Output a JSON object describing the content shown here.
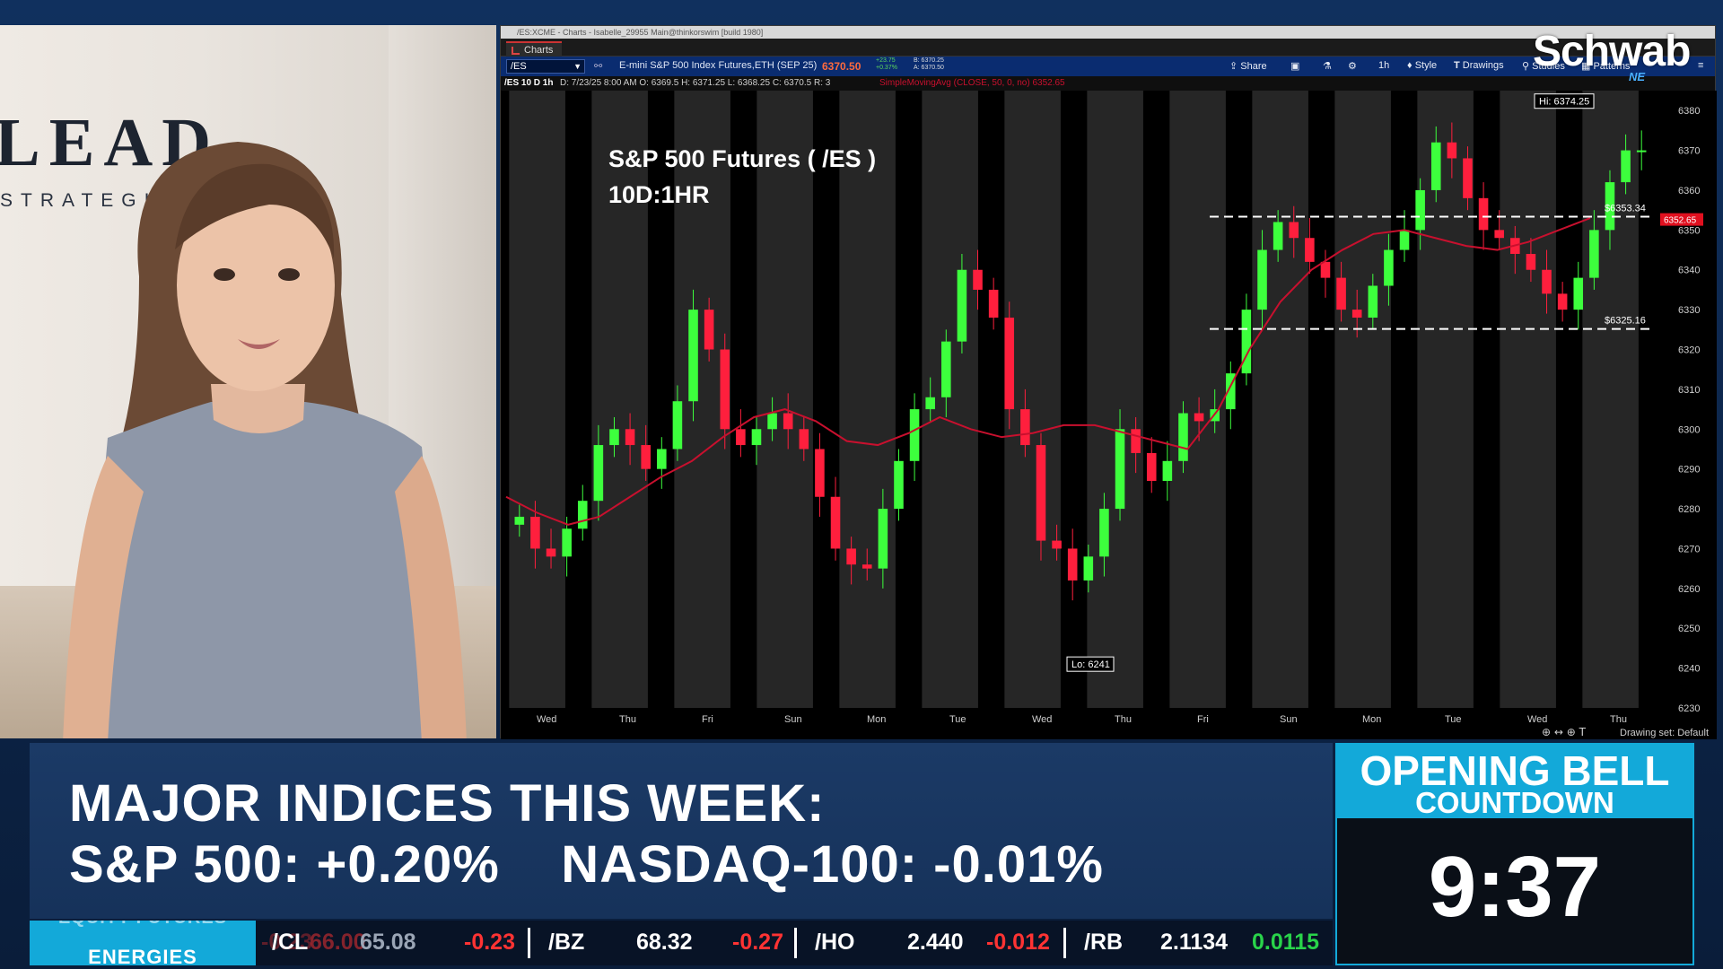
{
  "presenter": {
    "logo_main": "LEAD",
    "logo_sub": "STRATEGIES"
  },
  "chart_window": {
    "title_text": "/ES:XCME - Charts - Isabelle_29955 Main@thinkorswim [build 1980]",
    "tab_label": "Charts",
    "symbol": "/ES",
    "description": "E-mini S&P 500 Index Futures,ETH (SEP 25)",
    "last_price": "6370.50",
    "net_change": "+23.75",
    "pct_change": "+0.37%",
    "bid": "B: 6370.25",
    "ask": "A: 6370.50",
    "toolbar": {
      "share": "Share",
      "timeframe": "1h",
      "style": "Style",
      "drawings": "Drawings",
      "studies": "Studies",
      "patterns": "Patterns"
    },
    "info_bar": {
      "symbol_period": "/ES 10 D 1h",
      "ohlc": "D: 7/23/25 8:00 AM  O: 6369.5  H: 6371.25  L: 6368.25  C: 6370.5  R: 3",
      "study": "SimpleMovingAvg (CLOSE, 50, 0, no)  6352.65"
    },
    "footer": {
      "drawing_set": "Drawing set: Default"
    }
  },
  "chart_data": {
    "type": "candlestick",
    "title": "S&P 500 Futures ( /ES )",
    "subtitle": "10D:1HR",
    "ylim": [
      6230,
      6385
    ],
    "y_ticks": [
      6380,
      6370,
      6360,
      6350,
      6340,
      6330,
      6320,
      6310,
      6300,
      6290,
      6280,
      6270,
      6260,
      6250,
      6240,
      6230
    ],
    "x_labels": [
      "Wed",
      "Thu",
      "Fri",
      "Sun",
      "Mon",
      "Tue",
      "Wed",
      "Thu",
      "Fri",
      "Sun",
      "Mon",
      "Tue",
      "Wed",
      "Thu"
    ],
    "high_label": "Hi: 6374.25",
    "low_label": "Lo: 6241",
    "current_price_label": "6352.65",
    "horizontal_lines": [
      {
        "label": "$6353.34",
        "value": 6353.34
      },
      {
        "label": "$6325.16",
        "value": 6325.16
      }
    ],
    "moving_average": {
      "name": "SimpleMovingAvg (CLOSE, 50)",
      "values": [
        6283,
        6279,
        6276,
        6278,
        6283,
        6288,
        6292,
        6298,
        6303,
        6305,
        6302,
        6297,
        6296,
        6299,
        6303,
        6300,
        6298,
        6299,
        6301,
        6301,
        6299,
        6297,
        6295,
        6305,
        6320,
        6332,
        6340,
        6345,
        6349,
        6350,
        6348,
        6346,
        6345,
        6347,
        6350,
        6353
      ]
    },
    "closes": [
      6278,
      6270,
      6268,
      6275,
      6282,
      6296,
      6300,
      6296,
      6290,
      6295,
      6307,
      6330,
      6320,
      6300,
      6296,
      6300,
      6304,
      6300,
      6295,
      6283,
      6270,
      6266,
      6265,
      6280,
      6292,
      6305,
      6308,
      6322,
      6340,
      6335,
      6328,
      6305,
      6296,
      6272,
      6270,
      6262,
      6268,
      6280,
      6300,
      6294,
      6287,
      6292,
      6304,
      6302,
      6305,
      6314,
      6330,
      6345,
      6352,
      6348,
      6342,
      6338,
      6330,
      6328,
      6336,
      6345,
      6350,
      6360,
      6372,
      6368,
      6358,
      6350,
      6348,
      6344,
      6340,
      6334,
      6330,
      6338,
      6350,
      6362,
      6370,
      6370
    ]
  },
  "lower_third": {
    "headline1": "MAJOR INDICES THIS WEEK:",
    "headline2": "S&P 500: +0.20%    NASDAQ-100: -0.01%"
  },
  "opening_bell": {
    "title": "OPENING BELL",
    "subtitle": "COUNTDOWN",
    "time": "9:37"
  },
  "ticker": {
    "label_previous": "EQUITY FUTURES",
    "label": "ENERGIES",
    "partial_value": "-0.23",
    "items": [
      {
        "symbol": "/CL",
        "value": "65.08",
        "change": "-0.23",
        "ghost": "66.00"
      },
      {
        "symbol": "/BZ",
        "value": "68.32",
        "change": "-0.27"
      },
      {
        "symbol": "/HO",
        "value": "2.440",
        "change": "-0.012"
      },
      {
        "symbol": "/RB",
        "value": "2.1134",
        "change": "0.0115"
      }
    ]
  },
  "brand": {
    "logo": "Schwab",
    "badge": "NE"
  },
  "colors": {
    "up_candle": "#3dff3d",
    "down_candle": "#ff1f3d",
    "moving_average": "#c8102e",
    "session_band": "#262626",
    "accent_blue": "#13a9d9"
  }
}
